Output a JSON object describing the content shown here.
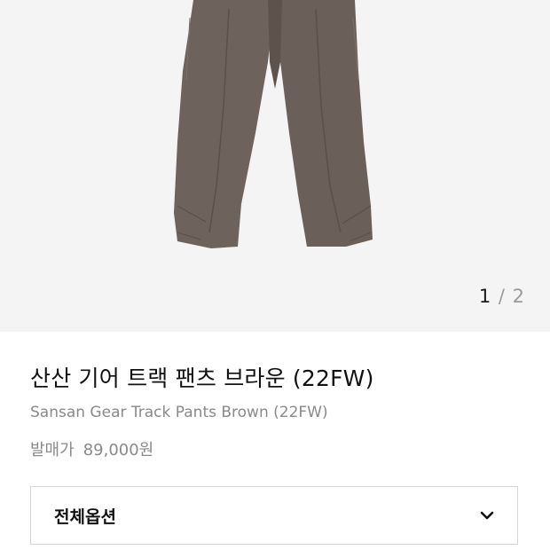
{
  "gallery": {
    "current": "1",
    "separator": " / ",
    "total": "2",
    "image_alt": "track-pants-brown"
  },
  "product": {
    "title": "산산 기어 트랙 팬츠 브라운 (22FW)",
    "subtitle": "Sansan Gear Track Pants Brown (22FW)",
    "price_label": "발매가",
    "price_value": "89,000원"
  },
  "options": {
    "label": "전체옵션",
    "icon": "chevron-down-icon"
  },
  "colors": {
    "pants": "#6e625d",
    "pants_shadow": "#5e524d",
    "background": "#f4f4f4"
  }
}
